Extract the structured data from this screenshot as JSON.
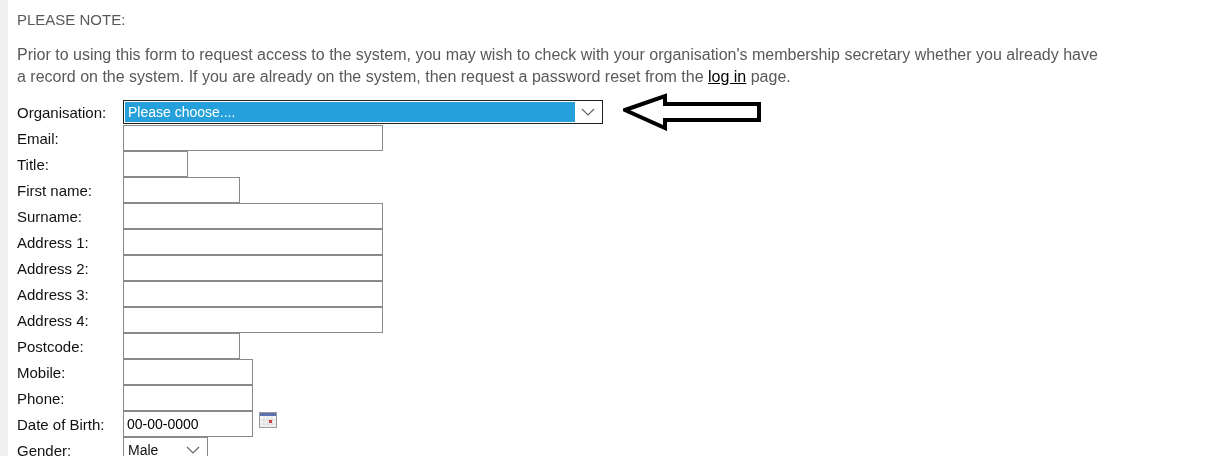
{
  "notice": {
    "heading": "PLEASE NOTE:",
    "text": "Prior to using this form to request access to the system, you may wish to check with your organisation's membership secretary whether you already have a record on the system. If you are already on the system, then request a password reset from the ",
    "link": "log in",
    "text_after": " page."
  },
  "fields": [
    {
      "label": "Organisation:",
      "kind": "select",
      "value": "Please choose....",
      "focused": true
    },
    {
      "label": "Email:",
      "kind": "text"
    },
    {
      "label": "Title:",
      "kind": "text"
    },
    {
      "label": "First name:",
      "kind": "text"
    },
    {
      "label": "Surname:",
      "kind": "text"
    },
    {
      "label": "Address 1:",
      "kind": "text"
    },
    {
      "label": "Address 2:",
      "kind": "text"
    },
    {
      "label": "Address 3:",
      "kind": "text"
    },
    {
      "label": "Address 4:",
      "kind": "text"
    },
    {
      "label": "Postcode:",
      "kind": "text"
    },
    {
      "label": "Mobile:",
      "kind": "text"
    },
    {
      "label": "Phone:",
      "kind": "text"
    },
    {
      "label": "Date of Birth:",
      "kind": "date",
      "value": "00-00-0000"
    },
    {
      "label": "Gender:",
      "kind": "select",
      "value": "Male",
      "focused": false
    }
  ]
}
